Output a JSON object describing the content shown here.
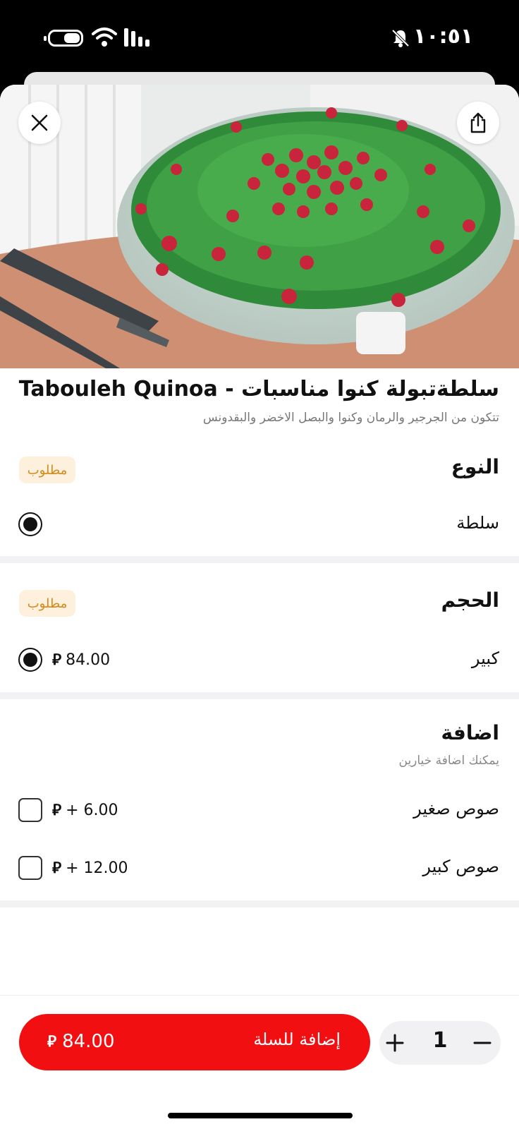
{
  "status_bar": {
    "time": "١٠:٥١",
    "icons": [
      "battery-icon",
      "wifi-icon",
      "signal-icon",
      "bell-muted-icon"
    ]
  },
  "product": {
    "title": "سلطةتبولة كنوا مناسبات  - Tabouleh Quinoa",
    "description": "تتكون من الجرجير والرمان وكنوا والبصل الاخضر والبقدونس",
    "image_alt": "tabouleh-salad-photo"
  },
  "sections": {
    "type": {
      "title": "النوع",
      "badge": "مطلوب",
      "options": [
        {
          "label": "سلطة",
          "selected": true
        }
      ]
    },
    "size": {
      "title": "الحجم",
      "badge": "مطلوب",
      "options": [
        {
          "label": "كبير",
          "price": "84.00",
          "selected": true
        }
      ]
    },
    "addons": {
      "title": "اضافة",
      "note": "يمكنك اضافة خيارين",
      "options": [
        {
          "label": "صوص صغير",
          "price": "+ 6.00",
          "checked": false
        },
        {
          "label": "صوص كبير",
          "price": "+ 12.00",
          "checked": false
        }
      ]
    }
  },
  "cart": {
    "add_label": "إضافة للسلة",
    "total": "84.00",
    "quantity": "1",
    "currency_icon": "riyal-icon"
  },
  "colors": {
    "accent": "#f20f12",
    "badge_bg": "#fdf0dc",
    "badge_text": "#d58a1c"
  }
}
